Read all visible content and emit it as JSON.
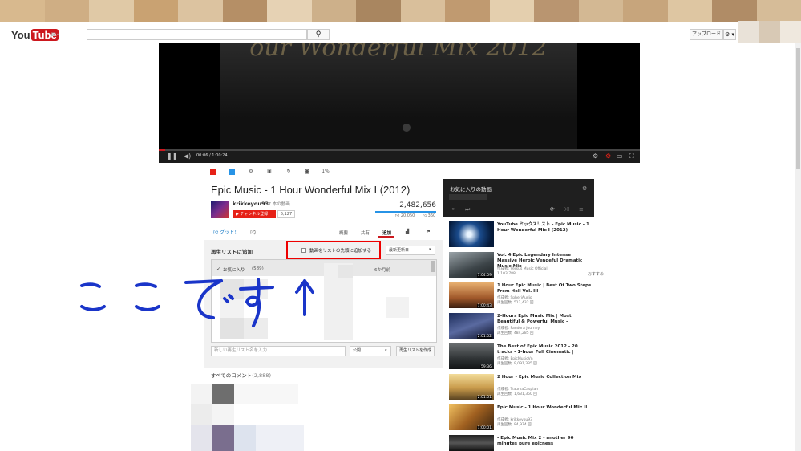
{
  "masthead": {
    "logo_you": "You",
    "logo_tube": "Tube",
    "upload_label": "アップロード",
    "settings_label": "⚙ ▾"
  },
  "player": {
    "video_title_art": "our Wonderful Mix 2012",
    "time": "00:06 / 1:00:24"
  },
  "video": {
    "title": "Epic Music - 1 Hour Wonderful Mix I (2012)",
    "channel": "krikkeyou93",
    "video_count": "97 本の動画",
    "subscribe_label": "チャンネル登録",
    "subscriber_count": "5,127",
    "views": "2,482,656",
    "likes": "20,050",
    "dislikes": "360",
    "good_label": "グッド！"
  },
  "tabs": {
    "summary": "概要",
    "share": "共有",
    "add": "追加",
    "stats_icon": "stats-icon",
    "flag_icon": "flag-icon"
  },
  "playlist_panel": {
    "heading": "再生リストに追加",
    "add_top_label": "動画をリストの先頭に追加する",
    "sort_label": "最新更新日",
    "row_name": "お気に入り",
    "row_count": "(589)",
    "row_date": "6か月前",
    "new_list_placeholder": "新しい再生リスト名を入力",
    "privacy_value": "公開",
    "create_label": "再生リストを作成"
  },
  "comments": {
    "heading": "すべてのコメント",
    "count": "(2,888)"
  },
  "sidebar": {
    "title": "お気に入りの動画",
    "rec_badge": "おすすめ",
    "items": [
      {
        "title": "YouTube ミックスリスト - Epic Music - 1 Hour Wonderful Mix I (2012)",
        "meta1": "",
        "meta2": "",
        "duration": ""
      },
      {
        "title": "Vol. 4 Epic Legendary Intense Massive Heroic Vengeful Dramatic Music Mix -",
        "meta1": "作成者: Versus Music Official",
        "meta2": "1,103,788",
        "duration": "1:04:09"
      },
      {
        "title": "1 Hour Epic Music | Best Of Two Steps From Hell Vol. III",
        "meta1": "作成者: SpheriAudio",
        "meta2": "再生回数: 512,432 回",
        "duration": "1:00:43"
      },
      {
        "title": "2-Hours Epic Music Mix | Most Beautiful & Powerful Music -",
        "meta1": "作成者: Pandora Journey",
        "meta2": "再生回数: 484,285 回",
        "duration": "2:01:02"
      },
      {
        "title": "The Best of Epic Music 2012 - 20 tracks - 1-hour Full Cinematic |",
        "meta1": "作成者: EpicMusicVn",
        "meta2": "再生回数: 9,091,335 回",
        "duration": "59:36"
      },
      {
        "title": "2 Hour - Epic Music Collection Mix",
        "meta1": "作成者: TraumaCaspian",
        "meta2": "再生回数: 1,631,350 回",
        "duration": "2:01:01"
      },
      {
        "title": "Epic Music - 1 Hour Wonderful Mix II",
        "meta1": "作成者: krikkeyou93",
        "meta2": "再生回数: 84,974 回",
        "duration": "1:00:01"
      },
      {
        "title": "- Epic Music Mix 2 - another 90 minutes pure epicness",
        "meta1": "",
        "meta2": "",
        "duration": ""
      }
    ]
  },
  "annotation": {
    "handwritten_text": "ここです↑"
  },
  "colors": {
    "youtube_red": "#cc181e",
    "highlight_red": "#e00000",
    "annotation_blue": "#1a35c9"
  }
}
